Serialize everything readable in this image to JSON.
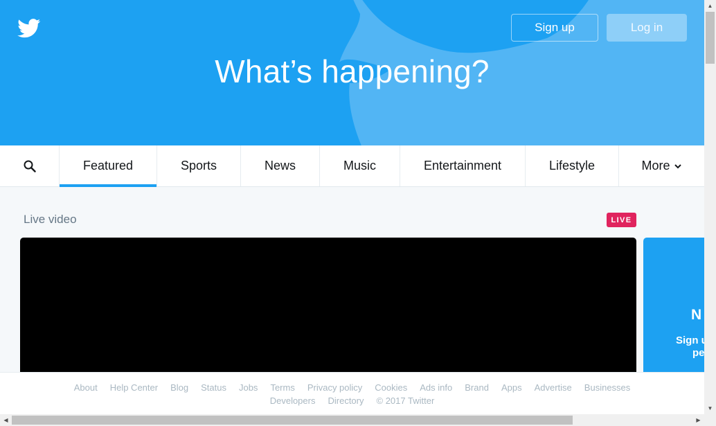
{
  "header": {
    "title": "What’s happening?",
    "signup_label": "Sign up",
    "login_label": "Log in",
    "brand_color": "#1da1f2"
  },
  "tabs": {
    "items": [
      {
        "label": "Featured"
      },
      {
        "label": "Sports"
      },
      {
        "label": "News"
      },
      {
        "label": "Music"
      },
      {
        "label": "Entertainment"
      },
      {
        "label": "Lifestyle"
      },
      {
        "label": "More"
      }
    ],
    "active": "Featured"
  },
  "live": {
    "section_title": "Live video",
    "badge": "LIVE",
    "badge_color": "#e0245e"
  },
  "side_card": {
    "title": "N",
    "text_line1": "Sign u",
    "text_line2": "pe"
  },
  "footer": {
    "links": [
      "About",
      "Help Center",
      "Blog",
      "Status",
      "Jobs",
      "Terms",
      "Privacy policy",
      "Cookies",
      "Ads info",
      "Brand",
      "Apps",
      "Advertise",
      "Businesses",
      "Developers",
      "Directory"
    ],
    "copyright": "© 2017 Twitter"
  },
  "icons": {
    "logo": "twitter-bird-icon",
    "search": "search-icon",
    "more": "chevron-down-icon"
  }
}
